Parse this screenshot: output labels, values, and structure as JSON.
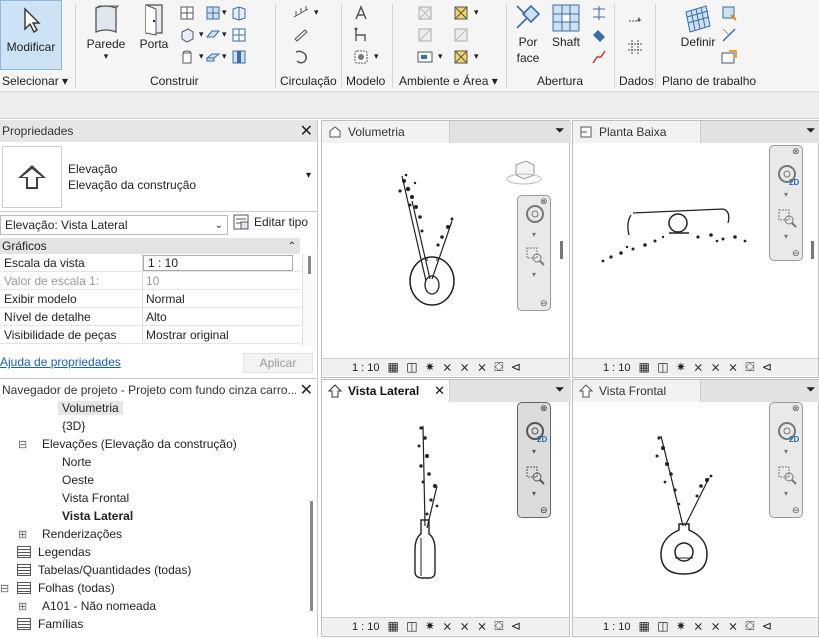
{
  "ribbon": {
    "modify": "Modificar",
    "select": "Selecionar",
    "wall": "Parede",
    "door": "Porta",
    "build": "Construir",
    "circulation": "Circulação",
    "model": "Modelo",
    "room_area": "Ambiente e Área",
    "by_face": "Por face",
    "by_face_l1": "Por",
    "by_face_l2": "face",
    "shaft": "Shaft",
    "opening": "Abertura",
    "datum": "Dados",
    "set": "Definir",
    "workplane": "Plano de trabalho"
  },
  "properties": {
    "title": "Propriedades",
    "type_line1": "Elevação",
    "type_line2": "Elevação da construção",
    "selector": "Elevação: Vista Lateral",
    "edit_type": "Editar tipo",
    "section": "Gráficos",
    "rows": [
      {
        "k": "Escala da vista",
        "v": "1 : 10"
      },
      {
        "k": "Valor de escala    1:",
        "v": "10"
      },
      {
        "k": "Exibir modelo",
        "v": "Normal"
      },
      {
        "k": "Nível de detalhe",
        "v": "Alto"
      },
      {
        "k": "Visibilidade de peças",
        "v": "Mostrar original"
      }
    ],
    "help": "Ajuda de propriedades",
    "apply": "Aplicar"
  },
  "browser": {
    "title": "Navegador de projeto - Projeto com fundo cinza carro...",
    "items": [
      {
        "label": "Volumetria",
        "indent": 62,
        "bold": false,
        "sel": true
      },
      {
        "label": "{3D}",
        "indent": 62
      },
      {
        "label": "Elevações (Elevação da construção)",
        "indent": 42,
        "exp": "−"
      },
      {
        "label": "Norte",
        "indent": 62
      },
      {
        "label": "Oeste",
        "indent": 62
      },
      {
        "label": "Vista Frontal",
        "indent": 62
      },
      {
        "label": "Vista Lateral",
        "indent": 62,
        "bold": true
      },
      {
        "label": "Renderizações",
        "indent": 42,
        "exp": "+"
      },
      {
        "label": "Legendas",
        "indent": 38,
        "icon": true
      },
      {
        "label": "Tabelas/Quantidades (todas)",
        "indent": 38,
        "icon": true
      },
      {
        "label": "Folhas (todas)",
        "indent": 38,
        "icon": true,
        "exp": "−"
      },
      {
        "label": "A101 - Não nomeada",
        "indent": 42,
        "exp": "+"
      },
      {
        "label": "Famílias",
        "indent": 38,
        "icon": true
      }
    ]
  },
  "views": {
    "v1": {
      "title": "Volumetria",
      "scale": "1 : 10"
    },
    "v2": {
      "title": "Planta Baixa",
      "scale": "1 : 10"
    },
    "v3": {
      "title": "Vista Lateral",
      "scale": "1 : 10"
    },
    "v4": {
      "title": "Vista Frontal",
      "scale": "1 : 10"
    },
    "badge2d": "2D"
  }
}
